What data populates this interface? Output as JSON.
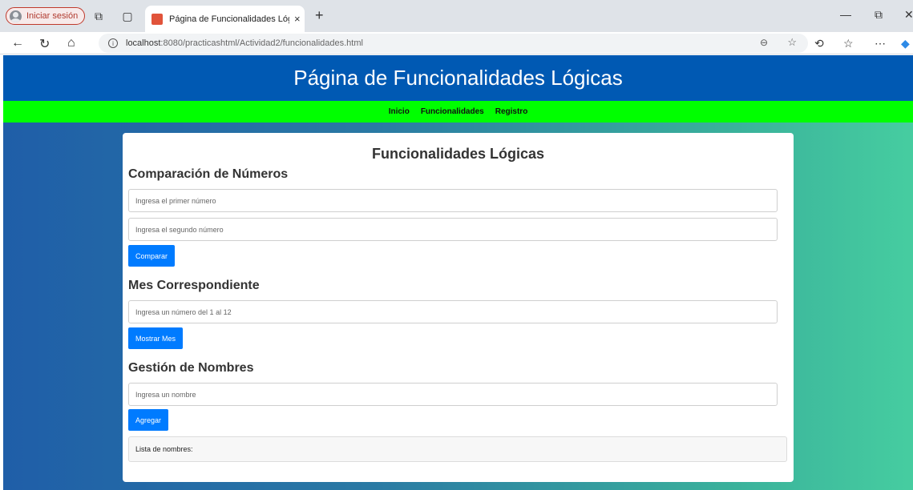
{
  "browser": {
    "profile_label": "Iniciar sesión",
    "tab_title": "Página de Funcionalidades Lógicas",
    "tab_close": "×",
    "new_tab": "+",
    "url_host": "localhost",
    "url_rest": ":8080/practicashtml/Actividad2/funcionalidades.html",
    "window_min": "—",
    "window_restore": "⧉",
    "window_close": "✕"
  },
  "site": {
    "title": "Página de Funcionalidades Lógicas",
    "nav": [
      "Inicio",
      "Funcionalidades",
      "Registro"
    ]
  },
  "card": {
    "heading": "Funcionalidades Lógicas",
    "compare": {
      "heading": "Comparación de Números",
      "first_placeholder": "Ingresa el primer número",
      "second_placeholder": "Ingresa el segundo número",
      "button": "Comparar"
    },
    "month": {
      "heading": "Mes Correspondiente",
      "placeholder": "Ingresa un número del 1 al 12",
      "button": "Mostrar Mes"
    },
    "names": {
      "heading": "Gestión de Nombres",
      "placeholder": "Ingresa un nombre",
      "button": "Agregar",
      "list_label": "Lista de nombres:"
    }
  },
  "colors": {
    "header_bg": "#0059b3",
    "nav_bg": "#00ff00",
    "button_bg": "#007bff"
  }
}
